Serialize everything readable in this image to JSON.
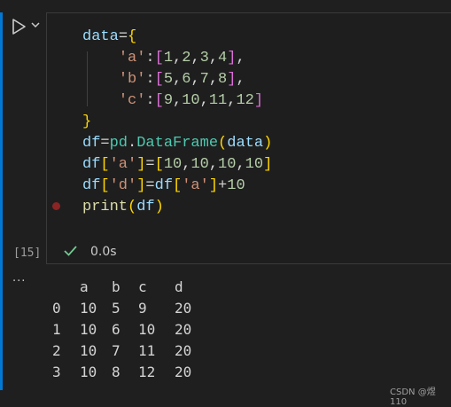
{
  "cell": {
    "code_lines": [
      [
        {
          "t": "data",
          "c": "var"
        },
        {
          "t": "=",
          "c": "op"
        },
        {
          "t": "{",
          "c": "br1"
        }
      ],
      [
        {
          "t": "    ",
          "c": "op"
        },
        {
          "t": "'a'",
          "c": "str"
        },
        {
          "t": ":",
          "c": "op"
        },
        {
          "t": "[",
          "c": "br2"
        },
        {
          "t": "1",
          "c": "num"
        },
        {
          "t": ",",
          "c": "op"
        },
        {
          "t": "2",
          "c": "num"
        },
        {
          "t": ",",
          "c": "op"
        },
        {
          "t": "3",
          "c": "num"
        },
        {
          "t": ",",
          "c": "op"
        },
        {
          "t": "4",
          "c": "num"
        },
        {
          "t": "]",
          "c": "br2"
        },
        {
          "t": ",",
          "c": "op"
        }
      ],
      [
        {
          "t": "    ",
          "c": "op"
        },
        {
          "t": "'b'",
          "c": "str"
        },
        {
          "t": ":",
          "c": "op"
        },
        {
          "t": "[",
          "c": "br2"
        },
        {
          "t": "5",
          "c": "num"
        },
        {
          "t": ",",
          "c": "op"
        },
        {
          "t": "6",
          "c": "num"
        },
        {
          "t": ",",
          "c": "op"
        },
        {
          "t": "7",
          "c": "num"
        },
        {
          "t": ",",
          "c": "op"
        },
        {
          "t": "8",
          "c": "num"
        },
        {
          "t": "]",
          "c": "br2"
        },
        {
          "t": ",",
          "c": "op"
        }
      ],
      [
        {
          "t": "    ",
          "c": "op"
        },
        {
          "t": "'c'",
          "c": "str"
        },
        {
          "t": ":",
          "c": "op"
        },
        {
          "t": "[",
          "c": "br2"
        },
        {
          "t": "9",
          "c": "num"
        },
        {
          "t": ",",
          "c": "op"
        },
        {
          "t": "10",
          "c": "num"
        },
        {
          "t": ",",
          "c": "op"
        },
        {
          "t": "11",
          "c": "num"
        },
        {
          "t": ",",
          "c": "op"
        },
        {
          "t": "12",
          "c": "num"
        },
        {
          "t": "]",
          "c": "br2"
        }
      ],
      [
        {
          "t": "}",
          "c": "br1"
        }
      ],
      [
        {
          "t": "df",
          "c": "var"
        },
        {
          "t": "=",
          "c": "op"
        },
        {
          "t": "pd",
          "c": "cls"
        },
        {
          "t": ".",
          "c": "op"
        },
        {
          "t": "DataFrame",
          "c": "cls"
        },
        {
          "t": "(",
          "c": "br1"
        },
        {
          "t": "data",
          "c": "var"
        },
        {
          "t": ")",
          "c": "br1"
        }
      ],
      [
        {
          "t": "df",
          "c": "var"
        },
        {
          "t": "[",
          "c": "br1"
        },
        {
          "t": "'a'",
          "c": "str"
        },
        {
          "t": "]",
          "c": "br1"
        },
        {
          "t": "=",
          "c": "op"
        },
        {
          "t": "[",
          "c": "br1"
        },
        {
          "t": "10",
          "c": "num"
        },
        {
          "t": ",",
          "c": "op"
        },
        {
          "t": "10",
          "c": "num"
        },
        {
          "t": ",",
          "c": "op"
        },
        {
          "t": "10",
          "c": "num"
        },
        {
          "t": ",",
          "c": "op"
        },
        {
          "t": "10",
          "c": "num"
        },
        {
          "t": "]",
          "c": "br1"
        }
      ],
      [
        {
          "t": "df",
          "c": "var"
        },
        {
          "t": "[",
          "c": "br1"
        },
        {
          "t": "'d'",
          "c": "str"
        },
        {
          "t": "]",
          "c": "br1"
        },
        {
          "t": "=",
          "c": "op"
        },
        {
          "t": "df",
          "c": "var"
        },
        {
          "t": "[",
          "c": "br1"
        },
        {
          "t": "'a'",
          "c": "str"
        },
        {
          "t": "]",
          "c": "br1"
        },
        {
          "t": "+",
          "c": "op"
        },
        {
          "t": "10",
          "c": "num"
        }
      ],
      [
        {
          "t": "print",
          "c": "fn"
        },
        {
          "t": "(",
          "c": "br1"
        },
        {
          "t": "df",
          "c": "var"
        },
        {
          "t": ")",
          "c": "br1"
        }
      ]
    ],
    "execution_count": "[15]",
    "duration": "0.0s",
    "status_icon": "check-icon",
    "run_icon": "play-icon",
    "expand_icon": "chevron-down-icon"
  },
  "output": {
    "more_label": "···",
    "header": [
      "",
      "a",
      "b",
      "c",
      "d"
    ],
    "rows": [
      [
        "0",
        "10",
        "5",
        "9",
        "20"
      ],
      [
        "1",
        "10",
        "6",
        "10",
        "20"
      ],
      [
        "2",
        "10",
        "7",
        "11",
        "20"
      ],
      [
        "3",
        "10",
        "8",
        "12",
        "20"
      ]
    ]
  },
  "watermark": "CSDN @煜110",
  "colors": {
    "accent": "#0078d4",
    "background": "#1f1f1f",
    "success": "#73c991",
    "breakpoint": "#c62828"
  }
}
